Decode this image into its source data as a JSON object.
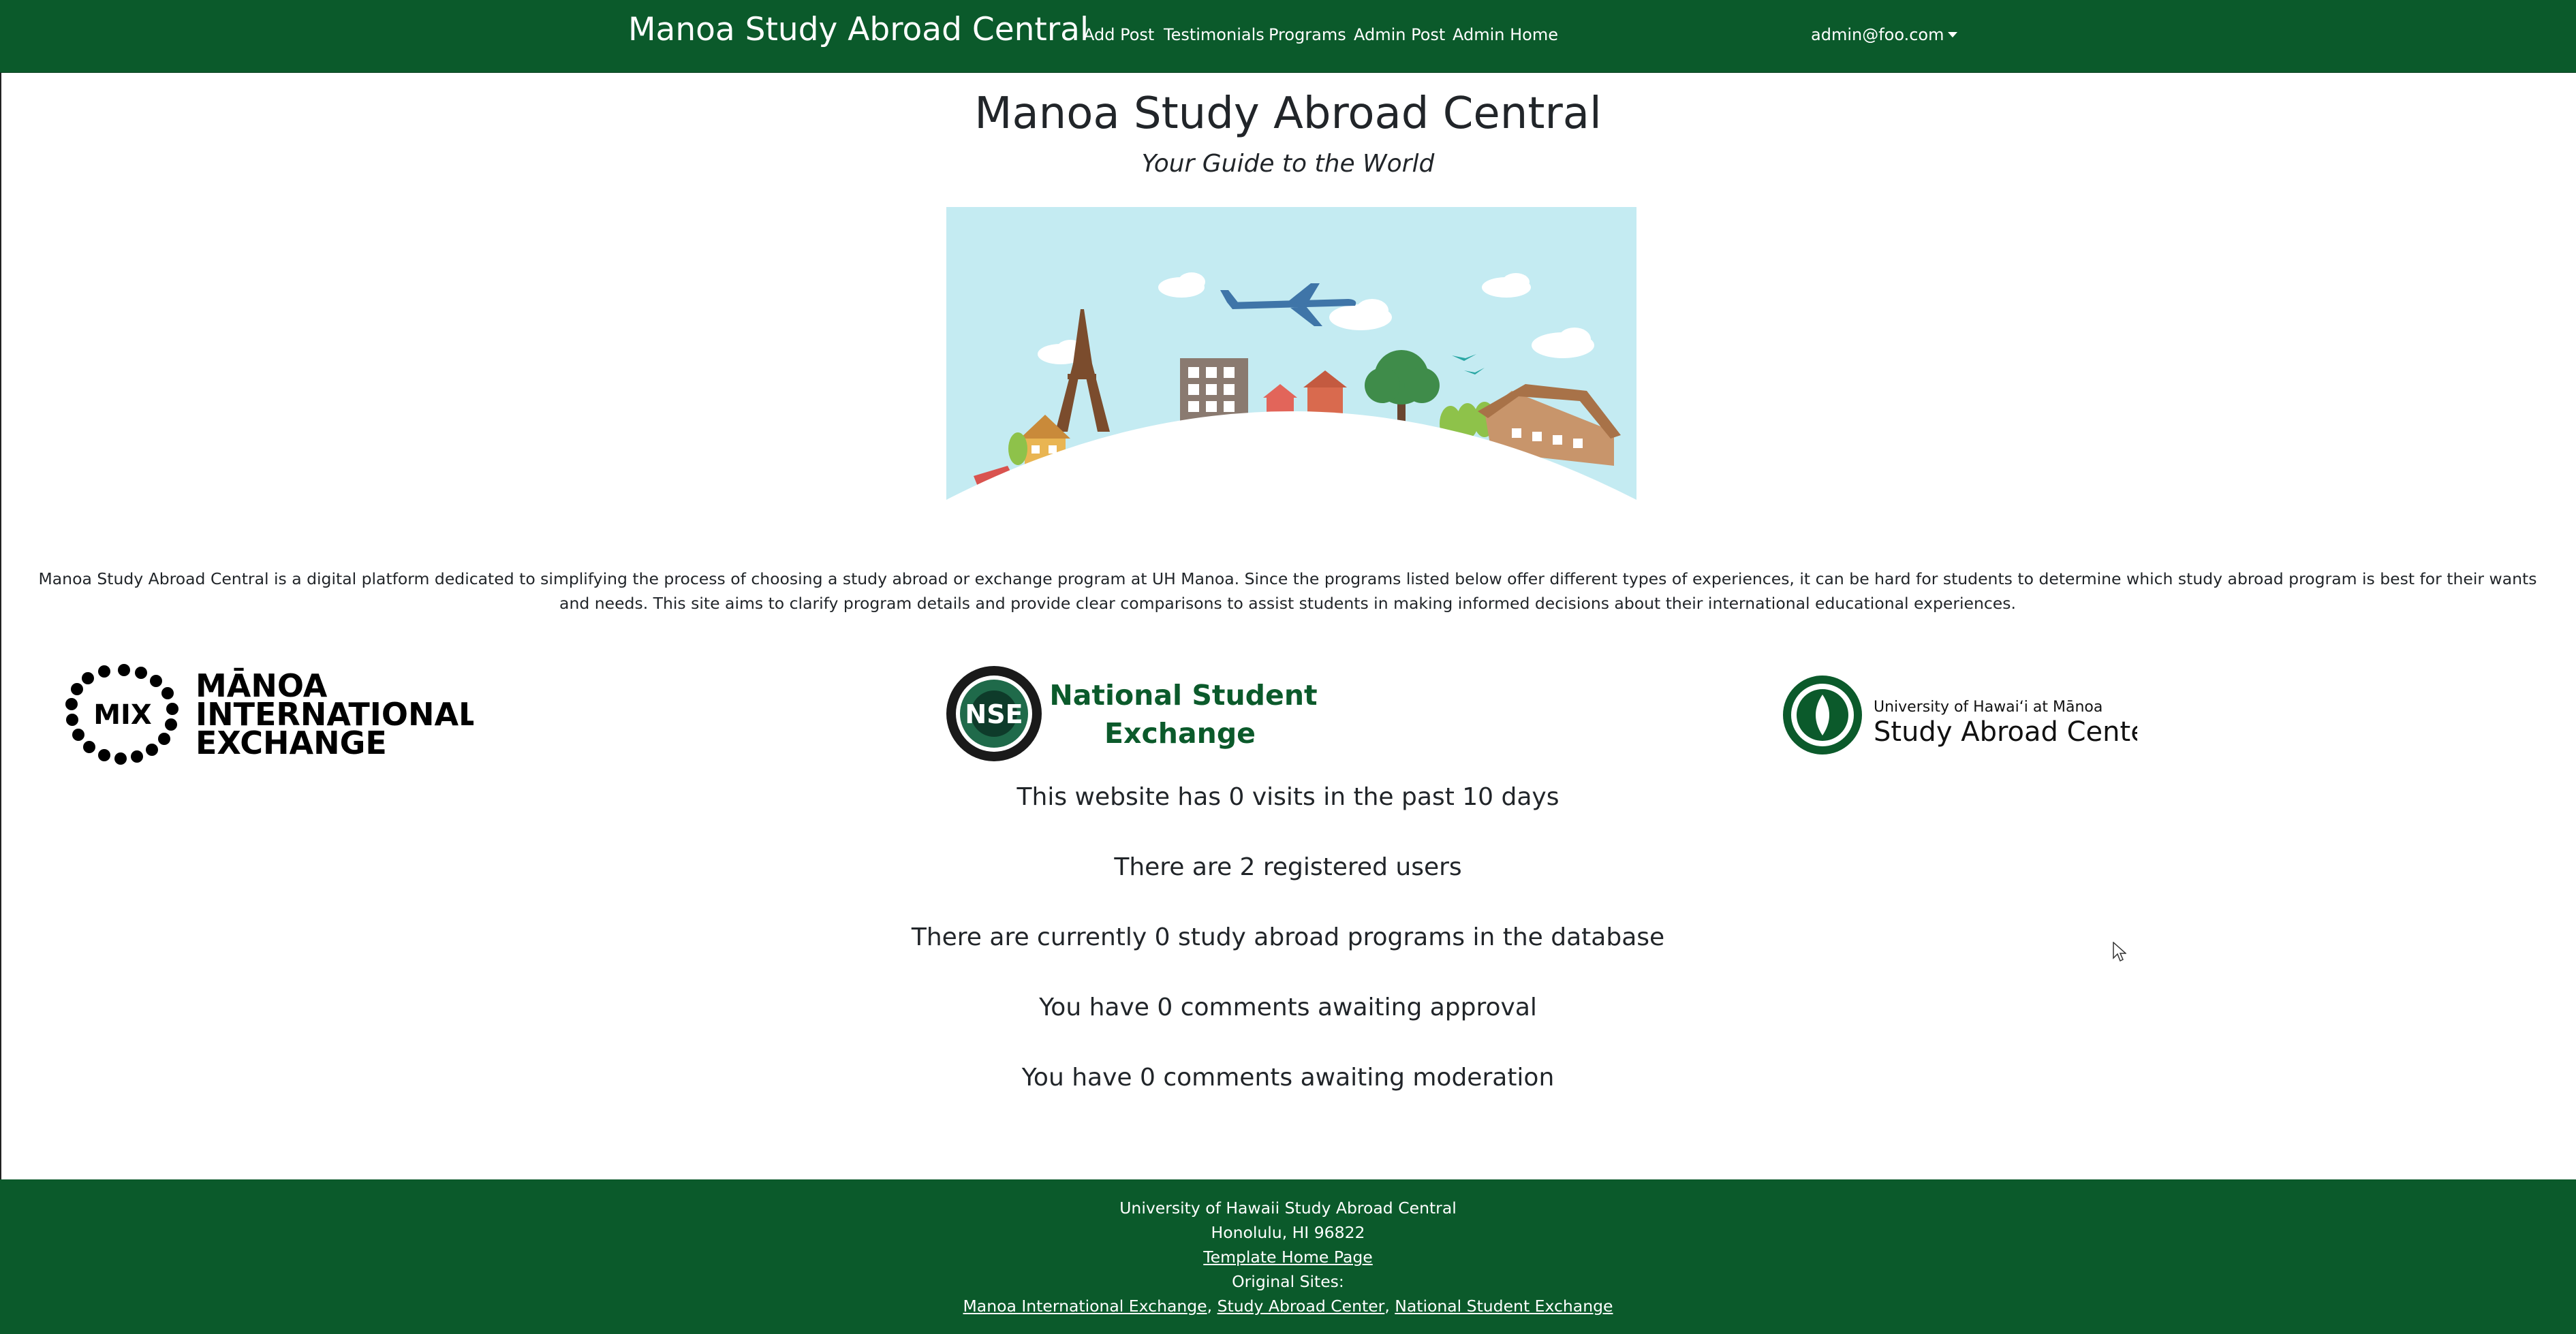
{
  "navbar": {
    "brand": "Manoa Study Abroad Central",
    "links": [
      "Add Post",
      "Testimonials",
      "Programs",
      "Admin Post",
      "Admin Home"
    ],
    "user": "admin@foo.com",
    "background": "#0b5a2b"
  },
  "header": {
    "title": "Manoa Study Abroad Central",
    "subtitle": "Your Guide to the World"
  },
  "description": "Manoa Study Abroad Central is a digital platform dedicated to simplifying the process of choosing a study abroad or exchange program at UH Manoa. Since the programs listed below offer different types of experiences, it can be hard for students to determine which study abroad program is best for their wants and needs. This site aims to clarify program details and provide clear comparisons to assist students in making informed decisions about their international educational experiences.",
  "logos": {
    "mix": {
      "badge": "MIX",
      "line1": "MĀNOA",
      "line2": "INTERNATIONAL",
      "line3": "EXCHANGE"
    },
    "nse": {
      "badge": "NSE",
      "line1": "National Student",
      "line2": "Exchange",
      "color": "#0b5a2b"
    },
    "sac": {
      "line1": "University of Hawai‘i at Mānoa",
      "line2": "Study Abroad Center",
      "color": "#0b5a2b"
    }
  },
  "stats": [
    "This website has 0 visits in the past 10 days",
    "There are 2 registered users",
    "There are currently 0 study abroad programs in the database",
    "You have 0 comments awaiting approval",
    "You have 0 comments awaiting moderation"
  ],
  "footer": {
    "line1": "University of Hawaii Study Abroad Central",
    "line2": "Honolulu, HI 96822",
    "template_link": "Template Home Page",
    "original_label": "Original Sites:",
    "sites": [
      "Manoa International Exchange",
      "Study Abroad Center",
      "National Student Exchange"
    ],
    "separator": ", "
  }
}
